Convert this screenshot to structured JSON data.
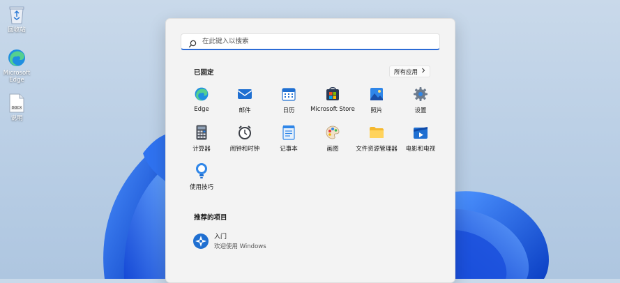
{
  "desktop": {
    "icons": [
      {
        "label": "回收站",
        "icon": "recycle-bin-icon"
      },
      {
        "label": "Microsoft Edge",
        "icon": "edge-icon"
      },
      {
        "label": "说明",
        "icon": "docx-file-icon",
        "file_ext": "DOCX"
      }
    ]
  },
  "start_menu": {
    "search": {
      "placeholder": "在此键入以搜索"
    },
    "pinned": {
      "title": "已固定",
      "all_apps_label": "所有应用",
      "apps": [
        {
          "label": "Edge",
          "icon": "edge-icon"
        },
        {
          "label": "邮件",
          "icon": "mail-icon"
        },
        {
          "label": "日历",
          "icon": "calendar-icon"
        },
        {
          "label": "Microsoft Store",
          "icon": "store-icon"
        },
        {
          "label": "照片",
          "icon": "photos-icon"
        },
        {
          "label": "设置",
          "icon": "gear-icon"
        },
        {
          "label": "计算器",
          "icon": "calculator-icon"
        },
        {
          "label": "闹钟和时钟",
          "icon": "alarm-clock-icon"
        },
        {
          "label": "记事本",
          "icon": "notepad-icon"
        },
        {
          "label": "画图",
          "icon": "paint-icon"
        },
        {
          "label": "文件资源管理器",
          "icon": "folder-icon"
        },
        {
          "label": "电影和电视",
          "icon": "movies-icon"
        },
        {
          "label": "使用技巧",
          "icon": "tips-icon"
        }
      ]
    },
    "recommended": {
      "title": "推荐的项目",
      "items": [
        {
          "title": "入门",
          "subtitle": "欢迎使用 Windows",
          "icon": "get-started-icon"
        }
      ]
    }
  },
  "colors": {
    "accent": "#2b6bd6",
    "menu_bg": "#f3f3f3",
    "wallpaper_blue": "#1e5fe0"
  }
}
